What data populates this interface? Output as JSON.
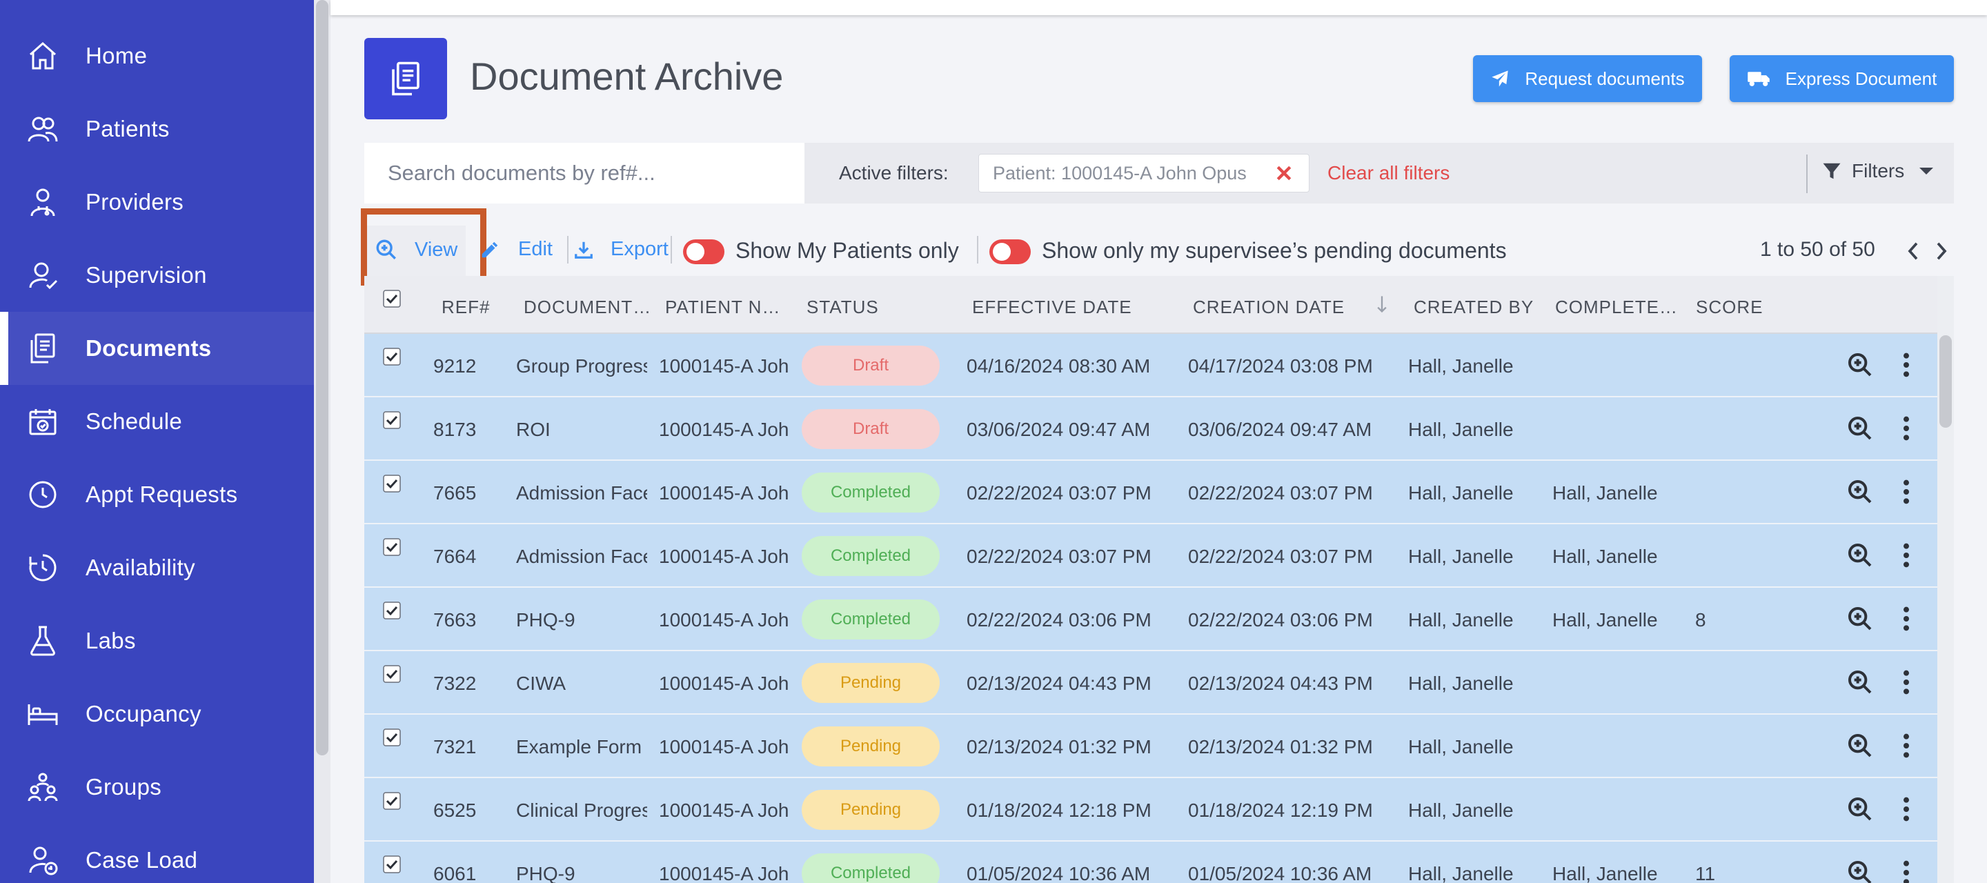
{
  "sidebar": {
    "items": [
      {
        "label": "Home",
        "icon": "home-icon"
      },
      {
        "label": "Patients",
        "icon": "patients-icon"
      },
      {
        "label": "Providers",
        "icon": "providers-icon"
      },
      {
        "label": "Supervision",
        "icon": "supervision-icon"
      },
      {
        "label": "Documents",
        "icon": "documents-icon",
        "active": true
      },
      {
        "label": "Schedule",
        "icon": "calendar-icon"
      },
      {
        "label": "Appt Requests",
        "icon": "clock-icon"
      },
      {
        "label": "Availability",
        "icon": "availability-icon"
      },
      {
        "label": "Labs",
        "icon": "flask-icon"
      },
      {
        "label": "Occupancy",
        "icon": "bed-icon"
      },
      {
        "label": "Groups",
        "icon": "groups-icon"
      },
      {
        "label": "Case Load",
        "icon": "caseload-icon"
      }
    ]
  },
  "header": {
    "title": "Document Archive",
    "request_button": "Request documents",
    "express_button": "Express Document"
  },
  "filters": {
    "search_placeholder": "Search documents by ref#...",
    "active_label": "Active filters:",
    "chip": "Patient: 1000145-A John Opus",
    "clear_all": "Clear all filters",
    "filters_button": "Filters"
  },
  "toolbar": {
    "view": "View",
    "edit": "Edit",
    "export": "Export",
    "toggle_my_patients": "Show My Patients only",
    "toggle_supervisee": "Show only my supervisee’s pending documents",
    "pager": "1 to 50 of 50"
  },
  "table": {
    "columns": [
      "REF#",
      "DOCUMENT…",
      "PATIENT N…",
      "STATUS",
      "EFFECTIVE DATE",
      "CREATION DATE",
      "CREATED BY",
      "COMPLETE…",
      "SCORE"
    ],
    "rows": [
      {
        "ref": "9212",
        "doc": "Group Progress",
        "patient": "1000145-A Joh",
        "status": "Draft",
        "effective": "04/16/2024 08:30 AM",
        "created": "04/17/2024 03:08 PM",
        "created_by": "Hall, Janelle",
        "completed_by": "",
        "score": ""
      },
      {
        "ref": "8173",
        "doc": "ROI",
        "patient": "1000145-A Joh",
        "status": "Draft",
        "effective": "03/06/2024 09:47 AM",
        "created": "03/06/2024 09:47 AM",
        "created_by": "Hall, Janelle",
        "completed_by": "",
        "score": ""
      },
      {
        "ref": "7665",
        "doc": "Admission Face",
        "patient": "1000145-A Joh",
        "status": "Completed",
        "effective": "02/22/2024 03:07 PM",
        "created": "02/22/2024 03:07 PM",
        "created_by": "Hall, Janelle",
        "completed_by": "Hall, Janelle",
        "score": ""
      },
      {
        "ref": "7664",
        "doc": "Admission Face",
        "patient": "1000145-A Joh",
        "status": "Completed",
        "effective": "02/22/2024 03:07 PM",
        "created": "02/22/2024 03:07 PM",
        "created_by": "Hall, Janelle",
        "completed_by": "Hall, Janelle",
        "score": ""
      },
      {
        "ref": "7663",
        "doc": "PHQ-9",
        "patient": "1000145-A Joh",
        "status": "Completed",
        "effective": "02/22/2024 03:06 PM",
        "created": "02/22/2024 03:06 PM",
        "created_by": "Hall, Janelle",
        "completed_by": "Hall, Janelle",
        "score": "8"
      },
      {
        "ref": "7322",
        "doc": "CIWA",
        "patient": "1000145-A Joh",
        "status": "Pending",
        "effective": "02/13/2024 04:43 PM",
        "created": "02/13/2024 04:43 PM",
        "created_by": "Hall, Janelle",
        "completed_by": "",
        "score": ""
      },
      {
        "ref": "7321",
        "doc": "Example Form",
        "patient": "1000145-A Joh",
        "status": "Pending",
        "effective": "02/13/2024 01:32 PM",
        "created": "02/13/2024 01:32 PM",
        "created_by": "Hall, Janelle",
        "completed_by": "",
        "score": ""
      },
      {
        "ref": "6525",
        "doc": "Clinical Progres",
        "patient": "1000145-A Joh",
        "status": "Pending",
        "effective": "01/18/2024 12:18 PM",
        "created": "01/18/2024 12:19 PM",
        "created_by": "Hall, Janelle",
        "completed_by": "",
        "score": ""
      },
      {
        "ref": "6061",
        "doc": "PHQ-9",
        "patient": "1000145-A Joh",
        "status": "Completed",
        "effective": "01/05/2024 10:36 AM",
        "created": "01/05/2024 10:36 AM",
        "created_by": "Hall, Janelle",
        "completed_by": "Hall, Janelle",
        "score": "11"
      }
    ]
  },
  "colors": {
    "sidebar": "#3a45be",
    "accent": "#3d8ff2",
    "row_selected": "#c5ddf5",
    "highlight": "#c85a2a",
    "danger": "#e24b4b"
  }
}
